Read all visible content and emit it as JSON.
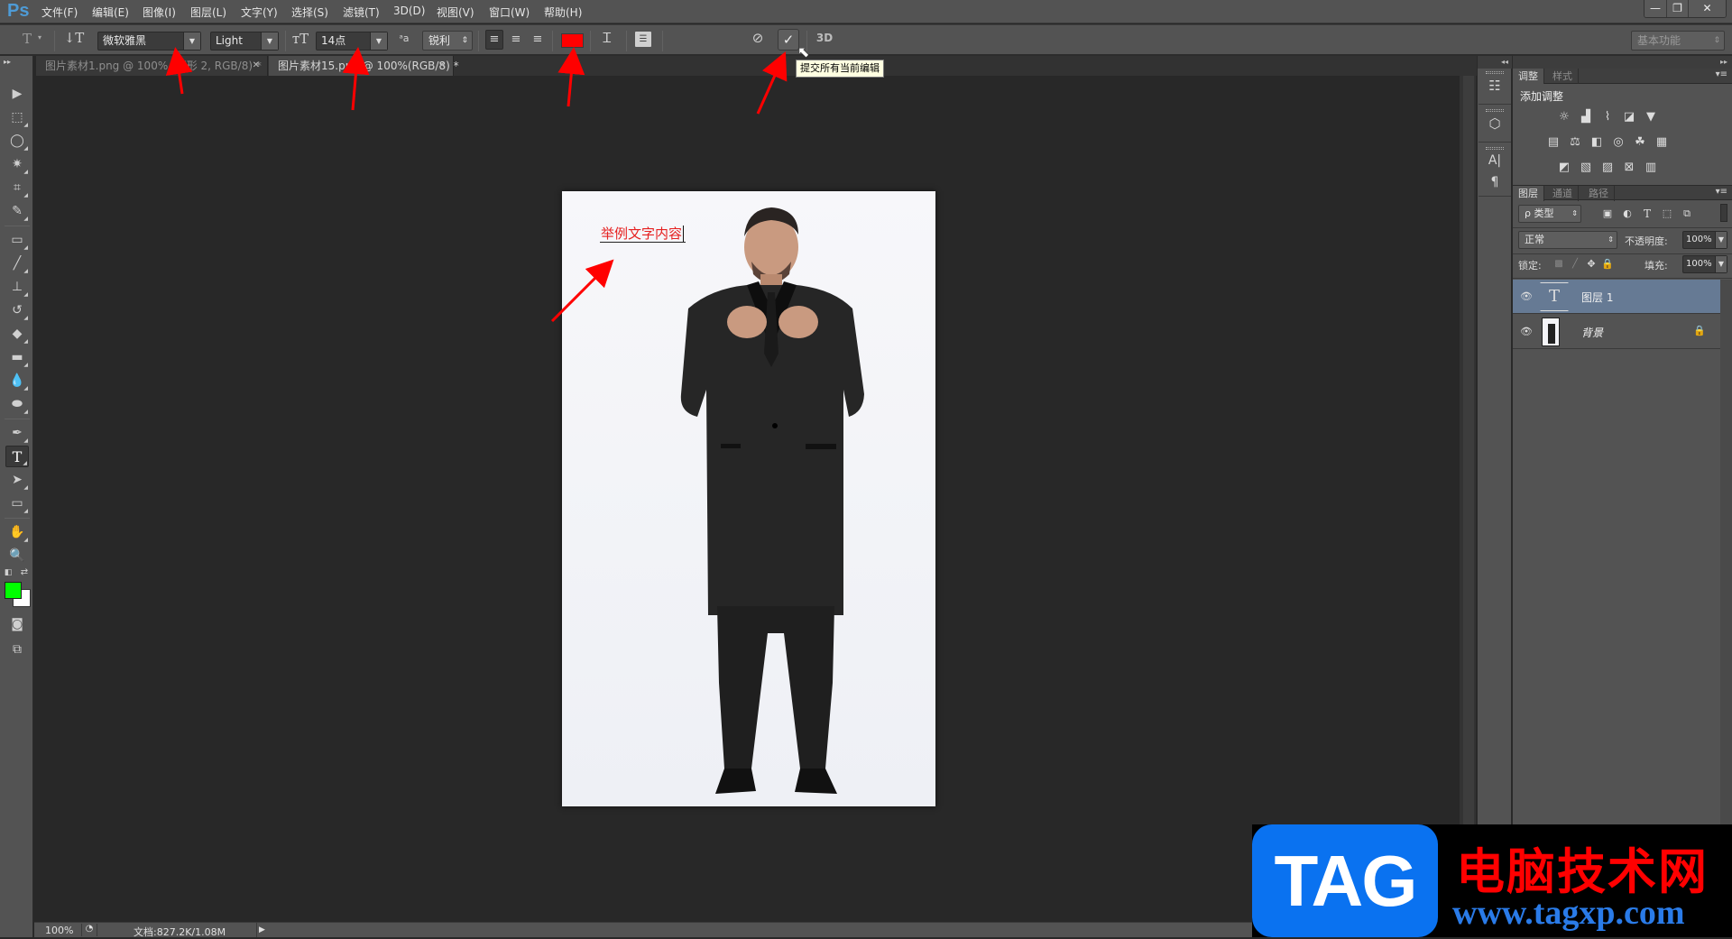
{
  "app": {
    "logo": "Ps",
    "menu": [
      "文件(F)",
      "编辑(E)",
      "图像(I)",
      "图层(L)",
      "文字(Y)",
      "选择(S)",
      "滤镜(T)",
      "3D(D)",
      "视图(V)",
      "窗口(W)",
      "帮助(H)"
    ],
    "window_buttons": {
      "minimize": "—",
      "restore": "❐",
      "close": "✕"
    }
  },
  "options_bar": {
    "tool_icon": "T",
    "font_family": "微软雅黑",
    "font_style": "Light",
    "font_size": "14点",
    "anti_alias_label": "ᵃa",
    "anti_alias": "锐利",
    "text_color": "#ff0000",
    "cancel_icon": "⃠",
    "commit_icon": "✓",
    "three_d": "3D",
    "workspace": "基本功能"
  },
  "tooltip": "提交所有当前编辑",
  "tabs": [
    {
      "label": "图片素材1.png @ 100% (矩形 2, RGB/8) *",
      "active": false
    },
    {
      "label": "图片素材15.png @ 100%(RGB/8) *",
      "active": true
    }
  ],
  "tools": [
    "move",
    "marquee",
    "lasso",
    "magic-wand",
    "crop",
    "eyedropper",
    "healing-brush",
    "brush",
    "clone-stamp",
    "history-brush",
    "eraser",
    "gradient",
    "blur",
    "dodge",
    "pen",
    "type",
    "path-selection",
    "rectangle",
    "hand",
    "zoom"
  ],
  "colors": {
    "foreground": "#00ff00",
    "background": "#ffffff"
  },
  "canvas": {
    "text": "举例文字内容",
    "text_color": "#e52020"
  },
  "status": {
    "zoom": "100%",
    "doc_info": "文档:827.2K/1.08M"
  },
  "adjustments_panel": {
    "tabs": [
      "调整",
      "样式"
    ],
    "title": "添加调整"
  },
  "layers_panel": {
    "tabs": [
      "图层",
      "通道",
      "路径"
    ],
    "filter_kind": "ρ 类型",
    "blend_mode": "正常",
    "opacity_label": "不透明度:",
    "opacity": "100%",
    "lock_label": "锁定:",
    "fill_label": "填充:",
    "fill": "100%",
    "layers": [
      {
        "name": "图层 1",
        "type": "text",
        "active": true,
        "visible": true
      },
      {
        "name": "背景",
        "type": "image",
        "active": false,
        "visible": true,
        "locked": true
      }
    ]
  },
  "watermark": {
    "tag": "TAG",
    "cn": "电脑技术网",
    "url": "www.tagxp.com"
  }
}
